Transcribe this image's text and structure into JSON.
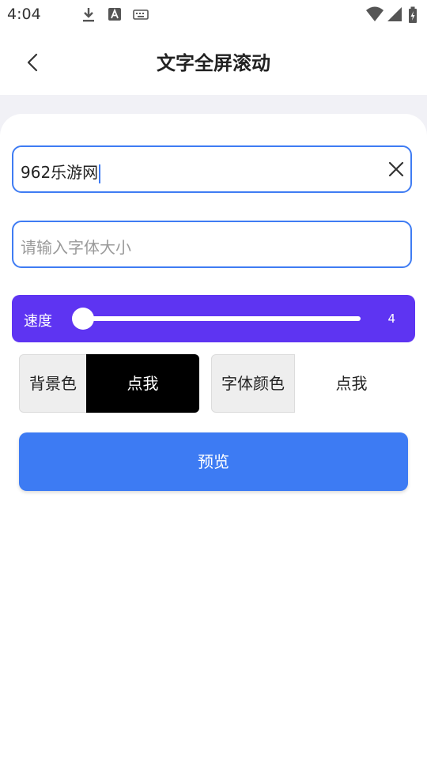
{
  "status_bar": {
    "time": "4:04",
    "icons": [
      "download-icon",
      "font-a-icon",
      "keyboard-icon",
      "wifi-icon",
      "signal-icon",
      "battery-icon"
    ]
  },
  "header": {
    "title": "文字全屏滚动"
  },
  "text_input": {
    "value": "962乐游网"
  },
  "font_size_input": {
    "value": "",
    "placeholder": "请输入字体大小"
  },
  "speed": {
    "label": "速度",
    "value": "4",
    "level_fraction": 0.0
  },
  "background_color": {
    "label": "背景色",
    "button_label": "点我",
    "color": "#000000",
    "text_color": "#ffffff"
  },
  "font_color": {
    "label": "字体颜色",
    "button_label": "点我",
    "color": "#ffffff",
    "text_color": "#222222"
  },
  "preview_button": {
    "label": "预览"
  },
  "colors": {
    "accent_blue": "#3f7cf3",
    "speed_purple": "#5e34f2"
  }
}
